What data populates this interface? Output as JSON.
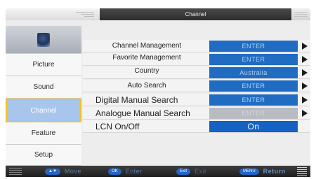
{
  "header": {
    "title": "Channel"
  },
  "sidebar": {
    "items": [
      {
        "label": "Picture"
      },
      {
        "label": "Sound"
      },
      {
        "label": "Channel",
        "selected": true
      },
      {
        "label": "Feature"
      },
      {
        "label": "Setup"
      }
    ]
  },
  "menu": {
    "rows": [
      {
        "label": "Channel Management",
        "value": "ENTER"
      },
      {
        "label": "Favorite Management",
        "value": "ENTER"
      },
      {
        "label": "Country",
        "value": "Australia"
      },
      {
        "label": "Auto Search",
        "value": "ENTER"
      },
      {
        "label": "Digital Manual Search",
        "value": "ENTER"
      },
      {
        "label": "Analogue Manual Search",
        "value": "ENTER",
        "disabled": true
      },
      {
        "label": "LCN On/Off",
        "value": "On"
      }
    ]
  },
  "footer": {
    "move": {
      "key": "▲▼",
      "label": "Move"
    },
    "enter": {
      "key": "OK",
      "label": "Enter"
    },
    "exit": {
      "key": "Exit",
      "label": "Exit"
    },
    "return": {
      "key": "MENU",
      "label": "Return"
    }
  },
  "colors": {
    "accent": "#1f6cc2",
    "selected_bg": "#a8c6ec",
    "selected_border": "#f0c02a",
    "title_bar": "#333333"
  },
  "icons": {
    "avatar": "tv-thumbnail-icon",
    "arrow": "triangle-right-icon"
  }
}
